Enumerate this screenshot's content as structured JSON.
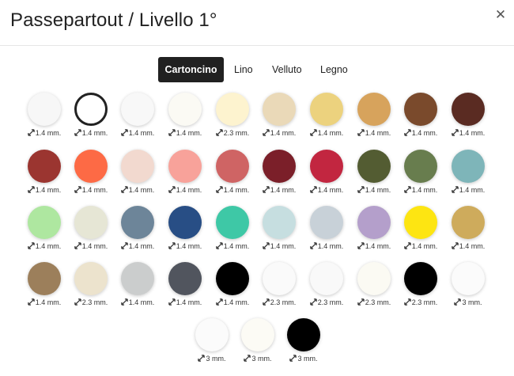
{
  "dialog": {
    "title": "Passepartout / Livello 1°",
    "close_icon": "close-icon"
  },
  "tabs": [
    {
      "label": "Cartoncino",
      "active": true
    },
    {
      "label": "Lino",
      "active": false
    },
    {
      "label": "Velluto",
      "active": false
    },
    {
      "label": "Legno",
      "active": false
    }
  ],
  "thickness_icon": "thickness-arrows-icon",
  "swatches": [
    {
      "color": "#f7f7f7",
      "thickness": "1.4 mm."
    },
    {
      "color": "#ffffff",
      "thickness": "1.4 mm.",
      "outlined": true
    },
    {
      "color": "#f8f8f8",
      "thickness": "1.4 mm."
    },
    {
      "color": "#fbfaf4",
      "thickness": "1.4 mm."
    },
    {
      "color": "#fdf3cf",
      "thickness": "2.3 mm."
    },
    {
      "color": "#ead9b8",
      "thickness": "1.4 mm."
    },
    {
      "color": "#ecd27e",
      "thickness": "1.4 mm."
    },
    {
      "color": "#d7a35c",
      "thickness": "1.4 mm."
    },
    {
      "color": "#7a4a2c",
      "thickness": "1.4 mm."
    },
    {
      "color": "#5a2b22",
      "thickness": "1.4 mm."
    },
    {
      "color": "#9b3530",
      "thickness": "1.4 mm."
    },
    {
      "color": "#fd6a45",
      "thickness": "1.4 mm."
    },
    {
      "color": "#f2d9cf",
      "thickness": "1.4 mm."
    },
    {
      "color": "#f8a29a",
      "thickness": "1.4 mm."
    },
    {
      "color": "#cf6464",
      "thickness": "1.4 mm."
    },
    {
      "color": "#7b1f29",
      "thickness": "1.4 mm."
    },
    {
      "color": "#c22640",
      "thickness": "1.4 mm."
    },
    {
      "color": "#535c32",
      "thickness": "1.4 mm."
    },
    {
      "color": "#687d4e",
      "thickness": "1.4 mm."
    },
    {
      "color": "#7eb5b9",
      "thickness": "1.4 mm."
    },
    {
      "color": "#aee7a0",
      "thickness": "1.4 mm."
    },
    {
      "color": "#e6e6d5",
      "thickness": "1.4 mm."
    },
    {
      "color": "#6d8599",
      "thickness": "1.4 mm."
    },
    {
      "color": "#284e85",
      "thickness": "1.4 mm."
    },
    {
      "color": "#3ec8a6",
      "thickness": "1.4 mm."
    },
    {
      "color": "#c6dee0",
      "thickness": "1.4 mm."
    },
    {
      "color": "#c8d1d8",
      "thickness": "1.4 mm."
    },
    {
      "color": "#b49fcb",
      "thickness": "1.4 mm."
    },
    {
      "color": "#fde512",
      "thickness": "1.4 mm."
    },
    {
      "color": "#ceab5c",
      "thickness": "1.4 mm."
    },
    {
      "color": "#9c7f5b",
      "thickness": "1.4 mm."
    },
    {
      "color": "#ece3cd",
      "thickness": "2.3 mm."
    },
    {
      "color": "#cbcdcd",
      "thickness": "1.4 mm."
    },
    {
      "color": "#51555e",
      "thickness": "1.4 mm."
    },
    {
      "color": "#000000",
      "thickness": "1.4 mm."
    },
    {
      "color": "#fafafa",
      "thickness": "2.3 mm."
    },
    {
      "color": "#f9f9f9",
      "thickness": "2.3 mm."
    },
    {
      "color": "#fbfaf3",
      "thickness": "2.3 mm."
    },
    {
      "color": "#000000",
      "thickness": "2.3 mm."
    },
    {
      "color": "#fbfbfb",
      "thickness": "3 mm."
    },
    {
      "color": "#fbfbfb",
      "thickness": "3 mm."
    },
    {
      "color": "#fcfbf5",
      "thickness": "3 mm."
    },
    {
      "color": "#000000",
      "thickness": "3 mm."
    }
  ]
}
